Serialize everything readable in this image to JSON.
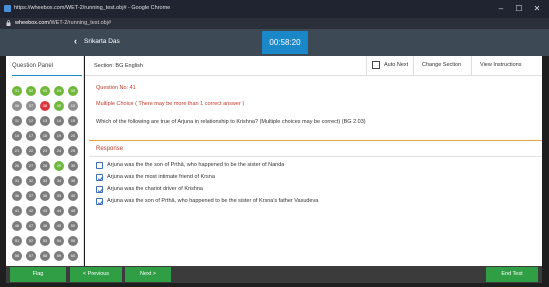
{
  "browser": {
    "window_title": "https://wheebox.com/WET-2/running_test.obj# - Google Chrome",
    "url_host": "wheebox.com",
    "url_path": "/WET-2/running_test.obj#"
  },
  "header": {
    "back_icon": "chevron-left-icon",
    "user_name": "Srikarta Das",
    "timer": "00:58:20"
  },
  "question_panel": {
    "title": "Question Panel",
    "questions": [
      {
        "n": "01",
        "status": "answered"
      },
      {
        "n": "02",
        "status": "answered"
      },
      {
        "n": "03",
        "status": "answered"
      },
      {
        "n": "04",
        "status": "answered"
      },
      {
        "n": "05",
        "status": "answered"
      },
      {
        "n": "06",
        "status": "visited"
      },
      {
        "n": "07",
        "status": "visited"
      },
      {
        "n": "08",
        "status": "current"
      },
      {
        "n": "09",
        "status": "answered"
      },
      {
        "n": "10",
        "status": "visited"
      },
      {
        "n": "11",
        "status": "unvisited"
      },
      {
        "n": "12",
        "status": "unvisited"
      },
      {
        "n": "13",
        "status": "unvisited"
      },
      {
        "n": "14",
        "status": "unvisited"
      },
      {
        "n": "15",
        "status": "unvisited"
      },
      {
        "n": "16",
        "status": "unvisited"
      },
      {
        "n": "17",
        "status": "unvisited"
      },
      {
        "n": "18",
        "status": "unvisited"
      },
      {
        "n": "19",
        "status": "unvisited"
      },
      {
        "n": "20",
        "status": "unvisited"
      },
      {
        "n": "21",
        "status": "unvisited"
      },
      {
        "n": "22",
        "status": "unvisited"
      },
      {
        "n": "23",
        "status": "unvisited"
      },
      {
        "n": "24",
        "status": "unvisited"
      },
      {
        "n": "25",
        "status": "unvisited"
      },
      {
        "n": "26",
        "status": "unvisited"
      },
      {
        "n": "27",
        "status": "unvisited"
      },
      {
        "n": "28",
        "status": "unvisited"
      },
      {
        "n": "29",
        "status": "answered"
      },
      {
        "n": "30",
        "status": "unvisited"
      },
      {
        "n": "31",
        "status": "unvisited"
      },
      {
        "n": "32",
        "status": "unvisited"
      },
      {
        "n": "33",
        "status": "unvisited"
      },
      {
        "n": "34",
        "status": "unvisited"
      },
      {
        "n": "35",
        "status": "unvisited"
      },
      {
        "n": "36",
        "status": "unvisited"
      },
      {
        "n": "37",
        "status": "unvisited"
      },
      {
        "n": "38",
        "status": "unvisited"
      },
      {
        "n": "39",
        "status": "unvisited"
      },
      {
        "n": "40",
        "status": "unvisited"
      },
      {
        "n": "41",
        "status": "unvisited"
      },
      {
        "n": "42",
        "status": "unvisited"
      },
      {
        "n": "43",
        "status": "unvisited"
      },
      {
        "n": "44",
        "status": "unvisited"
      },
      {
        "n": "45",
        "status": "unvisited"
      },
      {
        "n": "46",
        "status": "unvisited"
      },
      {
        "n": "47",
        "status": "unvisited"
      },
      {
        "n": "48",
        "status": "unvisited"
      },
      {
        "n": "49",
        "status": "unvisited"
      },
      {
        "n": "50",
        "status": "unvisited"
      },
      {
        "n": "51",
        "status": "unvisited"
      },
      {
        "n": "52",
        "status": "unvisited"
      },
      {
        "n": "53",
        "status": "unvisited"
      },
      {
        "n": "54",
        "status": "unvisited"
      },
      {
        "n": "55",
        "status": "unvisited"
      },
      {
        "n": "56",
        "status": "unvisited"
      },
      {
        "n": "57",
        "status": "unvisited"
      },
      {
        "n": "58",
        "status": "unvisited"
      },
      {
        "n": "59",
        "status": "unvisited"
      },
      {
        "n": "60",
        "status": "unvisited"
      }
    ]
  },
  "section_bar": {
    "section": "Section: BG English",
    "auto_next": "Auto Next",
    "change_section": "Change Section",
    "view_instructions": "View Instructions"
  },
  "question": {
    "number": "Question No: 41",
    "type": "Multiple Choice ( There may be more than 1 correct answer )",
    "text": "Which of the following are true of Arjuna in relationship to Krishna? (Multiple choices may be correct) (BG 2.03)"
  },
  "response": {
    "label": "Response",
    "options": [
      {
        "text": "Arjuna was the the son of Prthā, who happened to be the sister of Nanda",
        "checked": false
      },
      {
        "text": "Arjuna was the most intimate friend of Krsna",
        "checked": true
      },
      {
        "text": "Arjuna was the chariot driver of Krishna",
        "checked": true
      },
      {
        "text": "Arjuna was the son of Prthā, who happened to be the sister of Krsna's father Vasudeva",
        "checked": true
      }
    ]
  },
  "footer": {
    "flag": "Flag",
    "previous": "< Previous",
    "next": "Next >",
    "end_test": "End Test"
  },
  "colors": {
    "accent_blue": "#1a87c9",
    "answered_green": "#6fb83b",
    "current_red": "#d9363e",
    "button_green": "#2f9e44",
    "header_slate": "#3d4a56"
  }
}
